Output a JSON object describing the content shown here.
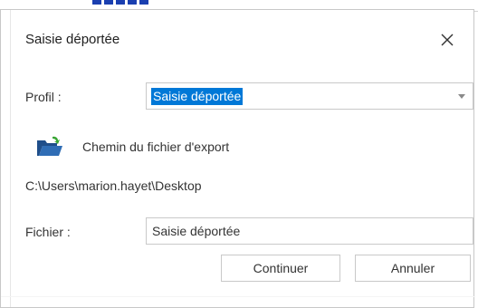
{
  "dialog": {
    "title": "Saisie déportée",
    "close_icon": "close-icon"
  },
  "profil": {
    "label": "Profil :",
    "selected_value": "Saisie déportée",
    "dropdown_icon": "chevron-down-icon"
  },
  "export": {
    "icon": "open-folder-icon",
    "label": "Chemin du fichier d'export",
    "path": "C:\\Users\\marion.hayet\\Desktop"
  },
  "fichier": {
    "label": "Fichier :",
    "value": "Saisie déportée"
  },
  "buttons": {
    "continue_label": "Continuer",
    "cancel_label": "Annuler"
  },
  "colors": {
    "selection": "#0078d7",
    "folder_body": "#1f4e8a",
    "folder_accent": "#3aa635",
    "border": "#c9c9c9"
  }
}
